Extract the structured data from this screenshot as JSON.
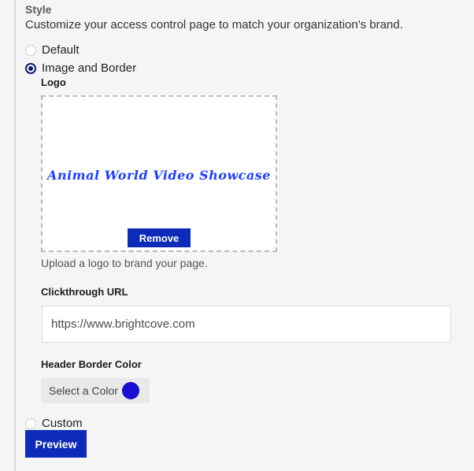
{
  "style_section": {
    "title": "Style",
    "description": "Customize your access control page to match your organization's brand.",
    "options": {
      "default": {
        "label": "Default",
        "selected": false
      },
      "image_and_border": {
        "label": "Image and Border",
        "selected": true
      },
      "custom": {
        "label": "Custom",
        "selected": false
      }
    }
  },
  "logo": {
    "label": "Logo",
    "image_text": "Animal World Video Showcase",
    "image_text_color": "#1e40ff",
    "remove_label": "Remove",
    "helper_text": "Upload a logo to brand your page."
  },
  "clickthrough": {
    "label": "Clickthrough URL",
    "value": "https://www.brightcove.com"
  },
  "header_border": {
    "label": "Header Border Color",
    "button_label": "Select a Color",
    "color": "#1a0fcf"
  },
  "actions": {
    "preview_label": "Preview"
  },
  "colors": {
    "primary_button": "#0d2bb8",
    "radio_checked": "#0a1a6b"
  }
}
